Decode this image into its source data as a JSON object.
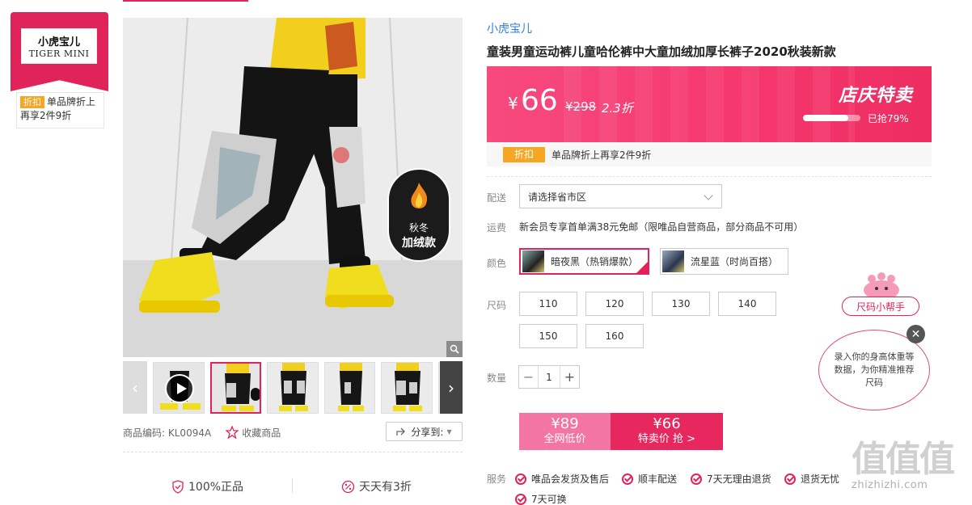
{
  "brand_card": {
    "logo_top": "小虎宝儿",
    "logo_bottom": "TIGER MINI",
    "discount_tag": "折扣",
    "promo_text": "单品牌折上再享2件9折"
  },
  "gallery": {
    "badge_line1": "秋冬",
    "badge_line2": "加绒款",
    "thumb_count": 6,
    "active_thumb_index": 1,
    "product_code_label": "商品编码:",
    "product_code": "KL0094A",
    "favorite_label": "收藏商品",
    "share_label": "分享到:",
    "guarantee_authentic": "100%正品",
    "guarantee_daily": "天天有3折"
  },
  "product": {
    "brand_name": "小虎宝儿",
    "title": "童装男童运动裤儿童哈伦裤中大童加绒加厚长裤子2020秋装新款"
  },
  "price": {
    "currency": "¥",
    "current": "66",
    "original": "¥298",
    "discount": "2.3折",
    "event_title": "店庆特卖",
    "sold_percent": 79,
    "sold_text": "已抢79%"
  },
  "promo": {
    "tag": "折扣",
    "text": "单品牌折上再享2件9折"
  },
  "delivery": {
    "label": "配送",
    "placeholder": "请选择省市区"
  },
  "shipping": {
    "label": "运费",
    "text": "新会员专享首单满38元免邮（限唯品自营商品，部分商品不可用）"
  },
  "colors": {
    "label": "颜色",
    "options": [
      "暗夜黑（热销爆款）",
      "流星蓝（时尚百搭）"
    ],
    "selected_index": 0
  },
  "sizes": {
    "label": "尺码",
    "options": [
      "110",
      "120",
      "130",
      "140",
      "150",
      "160"
    ]
  },
  "quantity": {
    "label": "数量",
    "value": "1"
  },
  "buy": {
    "market_price": "¥89",
    "market_label": "全网低价",
    "sale_price": "¥66",
    "sale_label": "特卖价 抢 >"
  },
  "service": {
    "label": "服务",
    "items": [
      "唯品会发货及售后",
      "顺丰配送",
      "7天无理由退货",
      "退货无忧",
      "7天可换"
    ]
  },
  "size_helper": {
    "title": "尺码小帮手",
    "text": "录入你的身高体重等数据，为你精准推荐尺码"
  },
  "watermark": {
    "big": "值值值",
    "small": "zhizhizhi.com"
  },
  "colors_theme": {
    "accent": "#e0245a",
    "link": "#2f7fd6",
    "tag": "#f5a623"
  }
}
